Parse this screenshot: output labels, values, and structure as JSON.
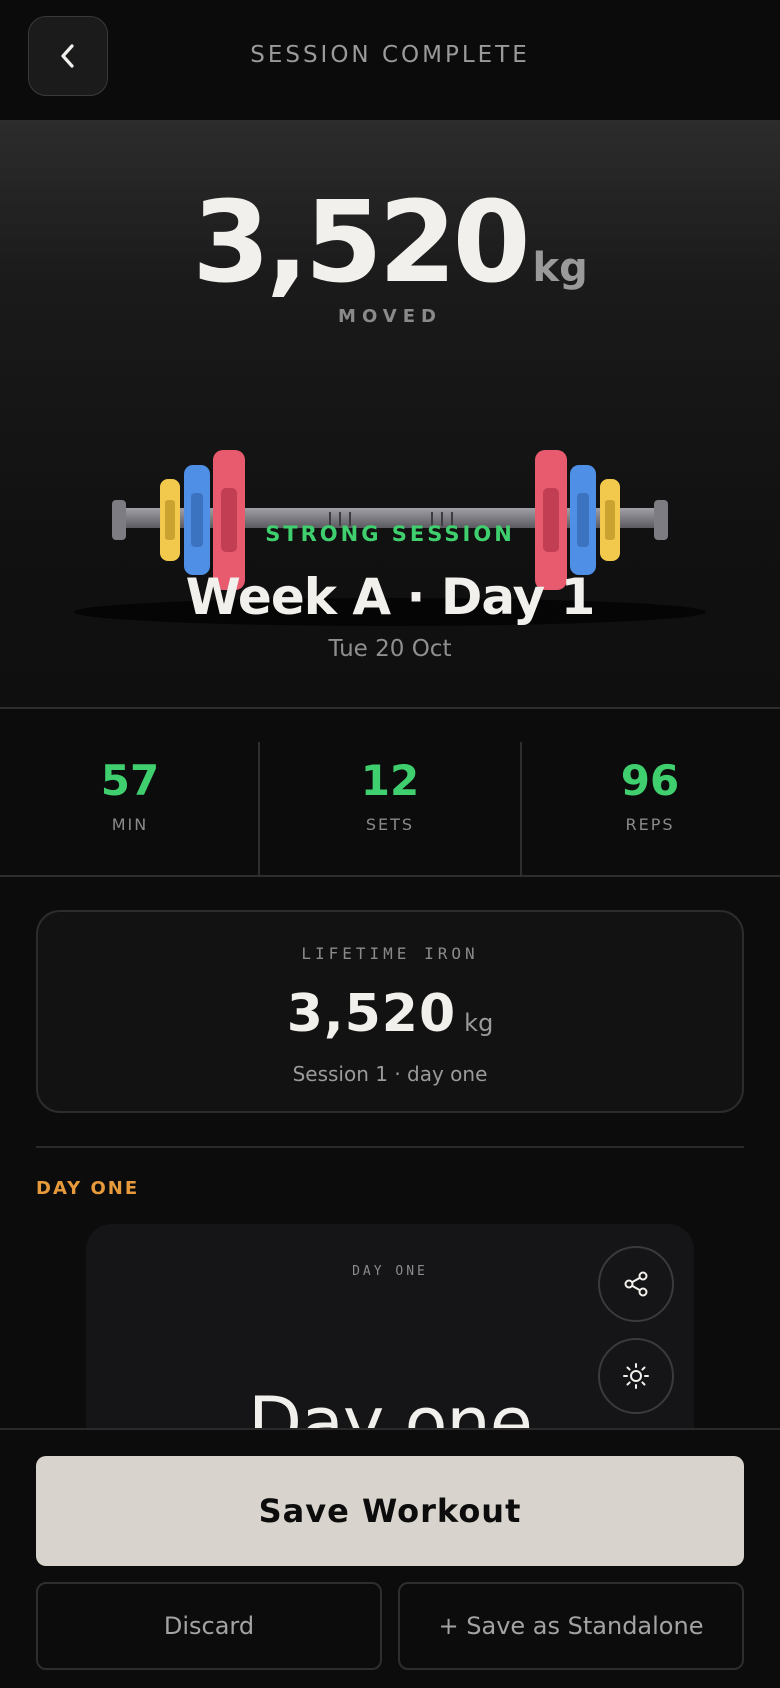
{
  "header": {
    "title": "SESSION COMPLETE",
    "back_icon": "chevron-left-icon"
  },
  "hero": {
    "total_value": "3,520",
    "total_unit": "kg",
    "moved_label": "MOVED",
    "verdict": "STRONG SESSION",
    "session_name": "Week A · Day 1",
    "date": "Tue 20 Oct",
    "plate_colors": {
      "yellow": "#f2c94c",
      "blue": "#4f8fe6",
      "red": "#e85a6e"
    }
  },
  "stats": [
    {
      "value": "57",
      "label": "MIN"
    },
    {
      "value": "12",
      "label": "SETS"
    },
    {
      "value": "96",
      "label": "REPS"
    }
  ],
  "lifetime": {
    "title": "LIFETIME IRON",
    "value": "3,520",
    "unit": "kg",
    "subtitle": "Session 1 · day one"
  },
  "section": {
    "label": "DAY ONE"
  },
  "day_card": {
    "label": "DAY ONE",
    "title": "Day one",
    "share_icon": "share-icon",
    "theme_icon": "sun-icon"
  },
  "actions": {
    "save": "Save Workout",
    "discard": "Discard",
    "standalone": "+ Save as Standalone"
  },
  "colors": {
    "accent_green": "#3fcf6e",
    "accent_orange": "#e79a3c",
    "background": "#0c0c0c",
    "save_button": "#d8d3cd"
  }
}
